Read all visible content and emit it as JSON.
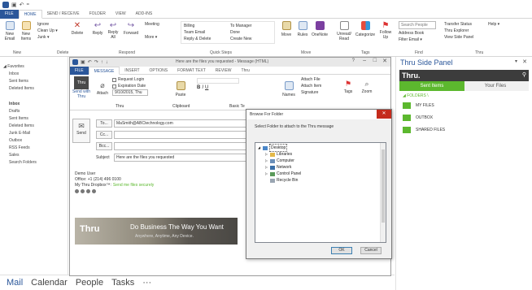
{
  "outlook": {
    "tabs": [
      "FILE",
      "HOME",
      "SEND / RECEIVE",
      "FOLDER",
      "VIEW",
      "ADD-INS"
    ],
    "ribbon": {
      "new_email": "New Email",
      "new_items": "New Items",
      "ignore": "Ignore",
      "clean_up": "Clean Up ▾",
      "junk": "Junk ▾",
      "delete": "Delete",
      "reply": "Reply",
      "reply_all": "Reply All",
      "forward": "Forward",
      "meeting": "Meeting",
      "more": "More ▾",
      "billing": "Billing",
      "team_email": "Team Email",
      "reply_delete": "Reply & Delete",
      "to_manager": "To Manager",
      "done": "Done",
      "create_new": "Create New",
      "move": "Move",
      "rules": "Rules",
      "onenote": "OneNote",
      "unread_read": "Unread/ Read",
      "categorize": "Categorize",
      "follow_up": "Follow Up",
      "search_people": "Search People",
      "address_book": "Address Book",
      "filter_email": "Filter Email ▾",
      "transfer_status": "Transfer Status",
      "thru_explorer": "Thru Explorer",
      "view_side_panel": "View Side Panel",
      "help": "Help ▾",
      "groups": [
        "New",
        "Delete",
        "Respond",
        "Quick Steps",
        "Move",
        "Tags",
        "Find",
        "Thru"
      ]
    },
    "left_nav": {
      "favorites_header": "◢ Favorites",
      "favorites": [
        "Inbox",
        "Sent Items",
        "Deleted Items"
      ],
      "account_items": [
        "Inbox",
        "Drafts",
        "Sent Items",
        "Deleted Items",
        "Junk E-Mail",
        "Outbox",
        "RSS Feeds",
        "Sales",
        "Search Folders"
      ]
    },
    "bottom_nav": [
      "Mail",
      "Calendar",
      "People",
      "Tasks",
      "···"
    ]
  },
  "message": {
    "title": "Here are the files you requested - Message (HTML)",
    "tabs": [
      "FILE",
      "MESSAGE",
      "INSERT",
      "OPTIONS",
      "FORMAT TEXT",
      "REVIEW",
      "Thru"
    ],
    "ribbon": {
      "send_with_thru": "Send with Thru",
      "attach": "Attach",
      "request_login": "Request Login",
      "expiration_date": "Expiration Date",
      "date_value": "9/10/2015, Thu",
      "thru_label": "Thru",
      "paste": "Paste",
      "clipboard": "Clipboard",
      "basic_text": "Basic Te",
      "names": "Names",
      "attach_file": "Attach File",
      "attach_item": "Attach Item",
      "signature": "Signature",
      "tags": "Tags",
      "zoom": "Zoom"
    },
    "to_label": "To...",
    "to_value": "MaSmith@ABCtechnology.com",
    "cc_label": "Cc...",
    "bcc_label": "Bcc...",
    "subject_label": "Subject",
    "subject_value": "Here are the files you requested",
    "send_label": "Send",
    "body": {
      "name": "Demo User",
      "office": "Office: +1 (214) 496 0100",
      "dropbox_prefix": "My Thru Dropbox™:",
      "dropbox_link": "Send me files securely",
      "banner_logo": "Thru",
      "banner_title": "Do Business The Way You Want",
      "banner_subtitle": "Anywhere, Anytime, Any Device."
    }
  },
  "side_panel": {
    "title": "Thru Side Panel",
    "logo": "Thru.",
    "tab_sent": "Sent Items",
    "tab_files": "Your Files",
    "folders": [
      "MY FILES",
      "OUTBOX",
      "SHARED FILES"
    ],
    "folders_header": "◢ FOLDERS \\"
  },
  "dialog": {
    "title": "Browse For Folder",
    "instruction": "Select Folder to attach to the Thru message",
    "tree": [
      "Desktop",
      "Libraries",
      "Computer",
      "Network",
      "Control Panel",
      "Recycle Bin"
    ],
    "ok": "OK",
    "cancel": "Cancel"
  },
  "colors": {
    "accent": "#2b579a",
    "thru_green": "#5cb82e",
    "panel_dark": "#3c3c3c"
  }
}
